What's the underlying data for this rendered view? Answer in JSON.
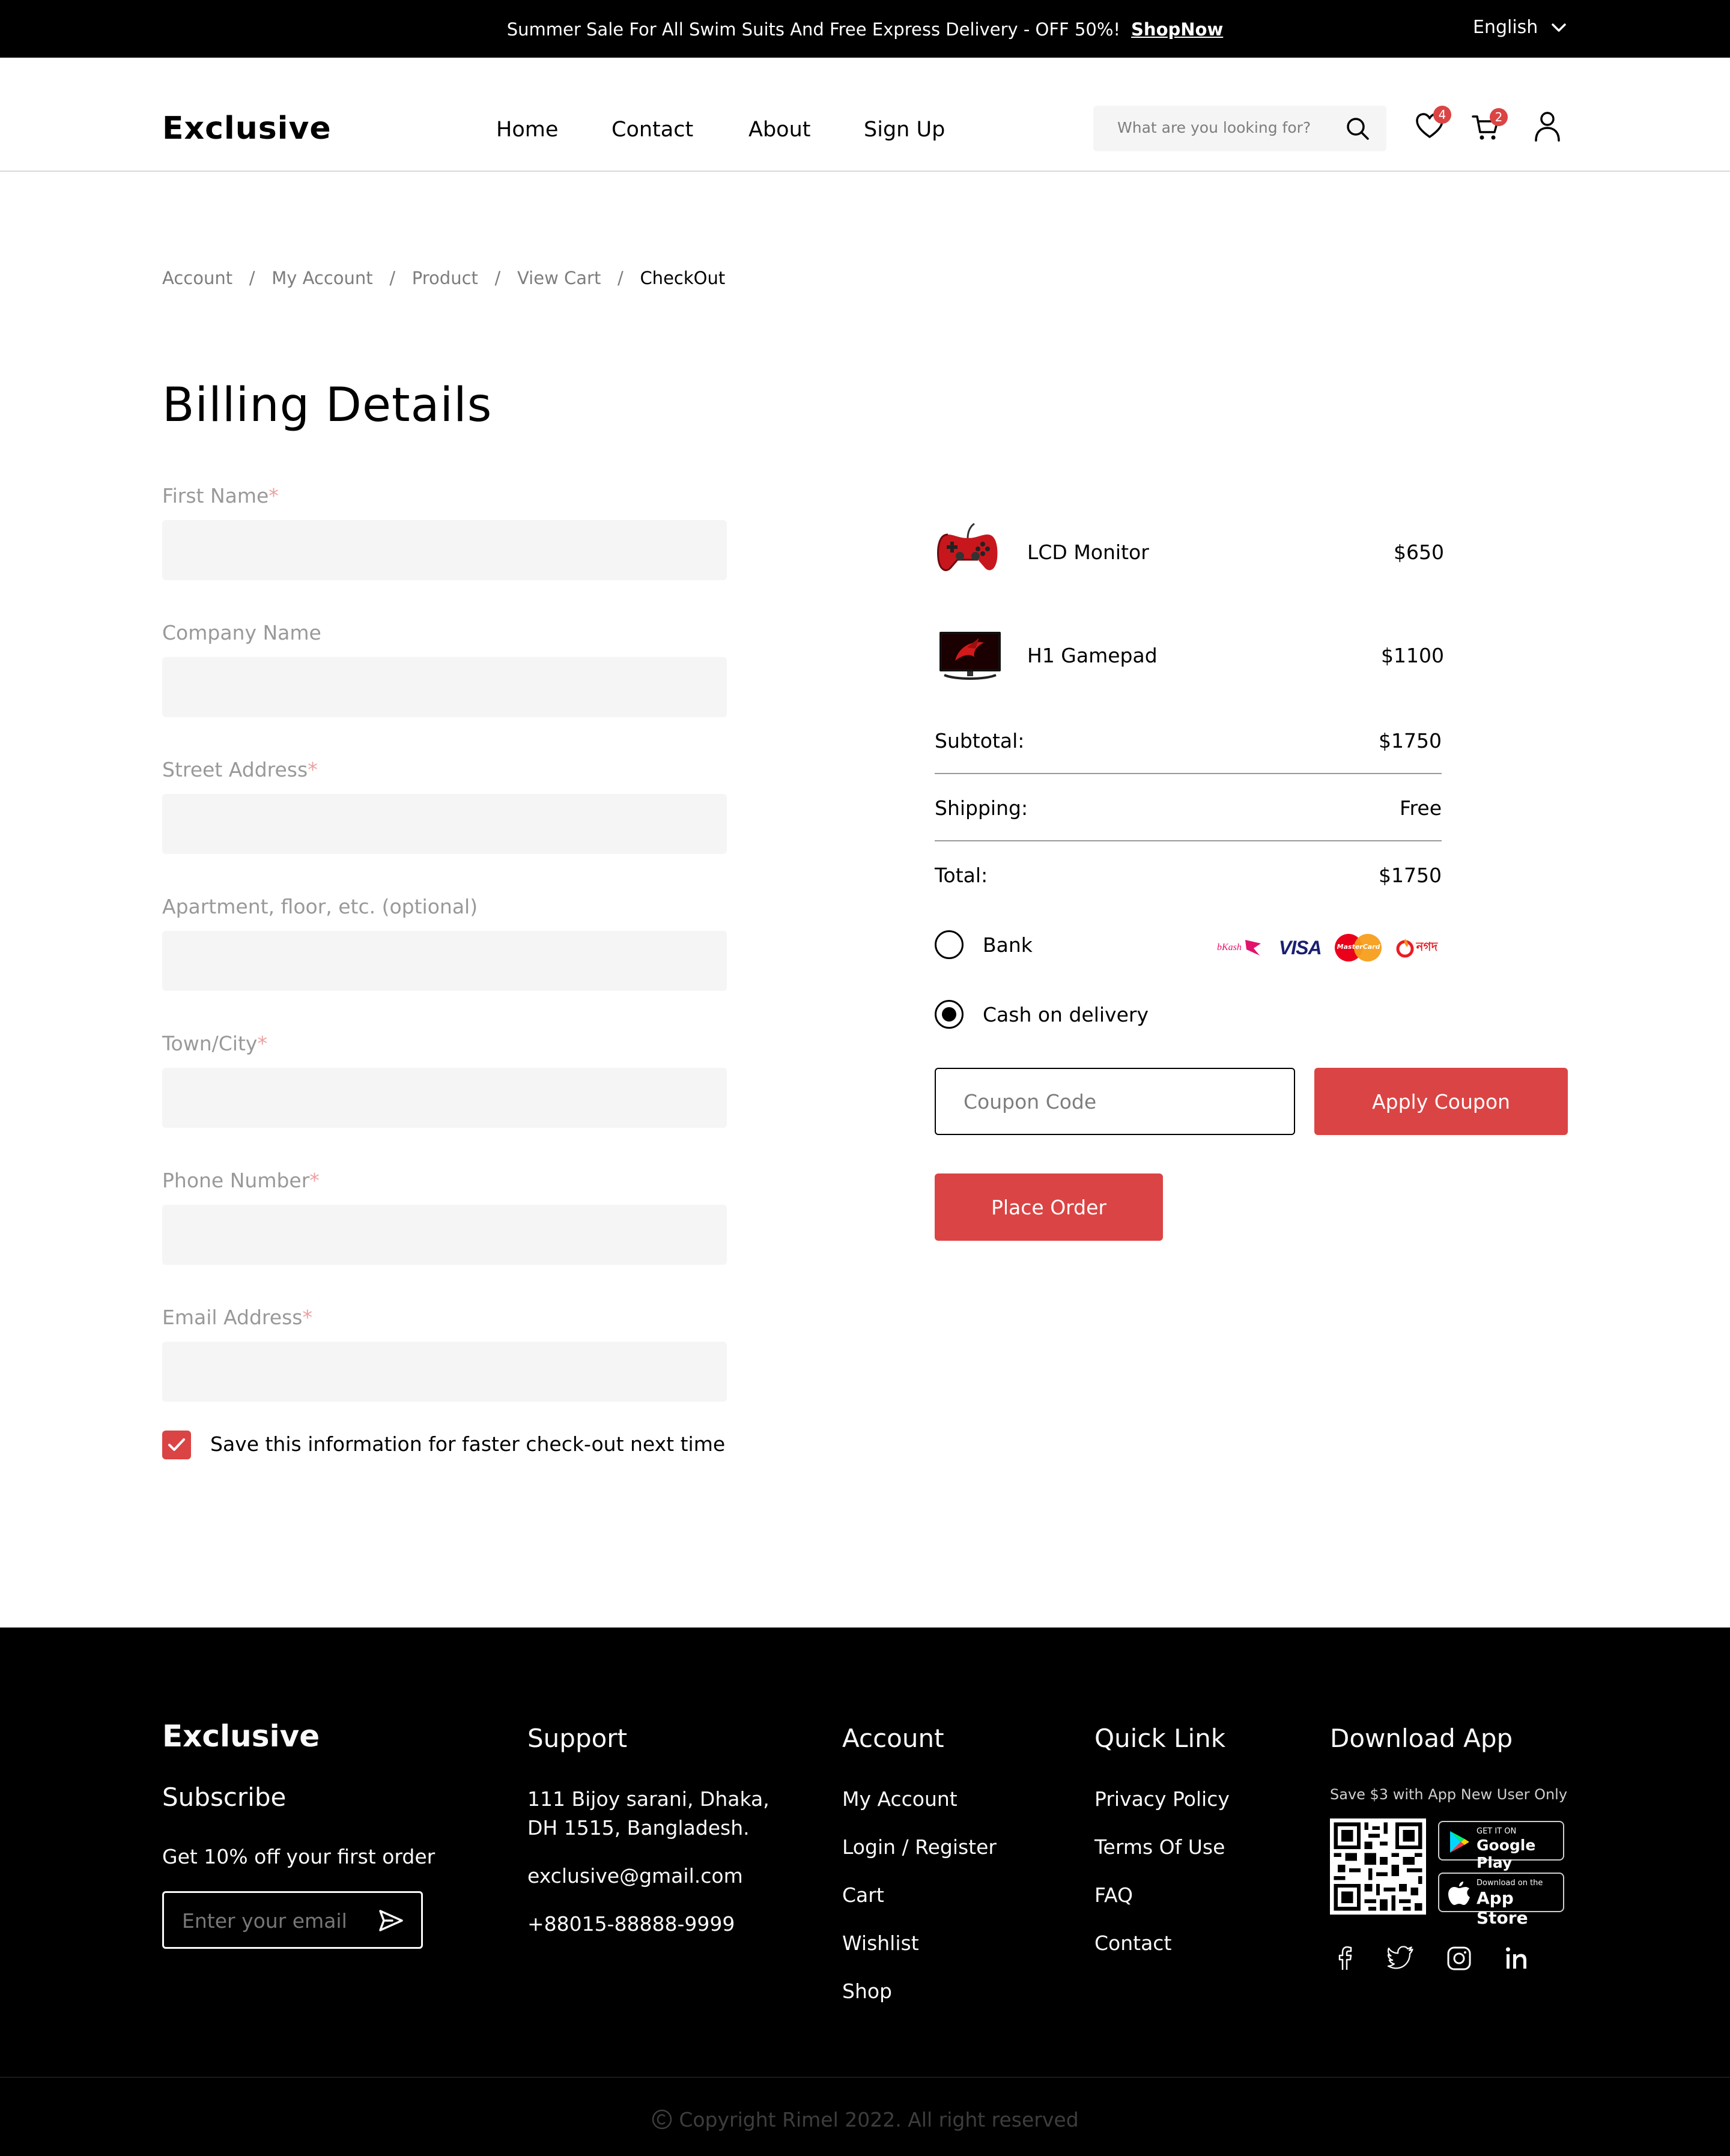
{
  "topbar": {
    "promo": "Summer Sale For All Swim Suits And Free Express Delivery - OFF 50%!",
    "shop_link": "ShopNow",
    "language": "English"
  },
  "header": {
    "logo": "Exclusive",
    "nav": [
      "Home",
      "Contact",
      "About",
      "Sign Up"
    ],
    "search_placeholder": "What are you looking for?",
    "wishlist_count": "4",
    "cart_count": "2"
  },
  "breadcrumb": {
    "items": [
      "Account",
      "My Account",
      "Product",
      "View Cart",
      "CheckOut"
    ],
    "separator": "/"
  },
  "billing": {
    "title": "Billing Details",
    "fields": [
      {
        "label": "First Name",
        "required": "*",
        "value": ""
      },
      {
        "label": "Company Name",
        "required": "",
        "value": ""
      },
      {
        "label": "Street Address",
        "required": "*",
        "value": ""
      },
      {
        "label": "Apartment, floor, etc. (optional)",
        "required": "",
        "value": ""
      },
      {
        "label": "Town/City",
        "required": "*",
        "value": ""
      },
      {
        "label": "Phone Number",
        "required": "*",
        "value": ""
      },
      {
        "label": "Email Address",
        "required": "*",
        "value": ""
      }
    ],
    "save_info": "Save this information for faster check-out next time",
    "save_checked": true
  },
  "order": {
    "items": [
      {
        "name": "LCD Monitor",
        "price": "$650",
        "image": "gamepad-image"
      },
      {
        "name": "H1 Gamepad",
        "price": "$1100",
        "image": "monitor-image"
      }
    ],
    "subtotal_label": "Subtotal:",
    "subtotal": "$1750",
    "shipping_label": "Shipping:",
    "shipping": "Free",
    "total_label": "Total:",
    "total": "$1750",
    "payment_options": [
      {
        "label": "Bank",
        "selected": false
      },
      {
        "label": "Cash on delivery",
        "selected": true
      }
    ],
    "payment_logos": {
      "bkash": "bKash",
      "visa": "VISA",
      "mastercard": "MasterCard",
      "nagad": "নগদ"
    },
    "coupon_placeholder": "Coupon Code",
    "apply_coupon": "Apply Coupon",
    "place_order": "Place Order"
  },
  "footer": {
    "brand": "Exclusive",
    "subscribe": "Subscribe",
    "offer": "Get 10% off your first order",
    "email_placeholder": "Enter your email",
    "support_title": "Support",
    "address_line1": "111 Bijoy sarani, Dhaka,",
    "address_line2": "DH 1515, Bangladesh.",
    "email": "exclusive@gmail.com",
    "phone": "+88015-88888-9999",
    "account_title": "Account",
    "account_links": [
      "My Account",
      "Login / Register",
      "Cart",
      "Wishlist",
      "Shop"
    ],
    "quick_title": "Quick Link",
    "quick_links": [
      "Privacy Policy",
      "Terms Of Use",
      "FAQ",
      "Contact"
    ],
    "app_title": "Download App",
    "app_offer": "Save $3 with App New User Only",
    "google_small": "GET IT ON",
    "google_big": "Google Play",
    "apple_small": "Download on the",
    "apple_big": "App Store",
    "copyright": "Copyright Rimel 2022. All right reserved"
  },
  "colors": {
    "accent": "#DB4444",
    "black": "#000000",
    "input_bg": "#F5F5F5"
  }
}
